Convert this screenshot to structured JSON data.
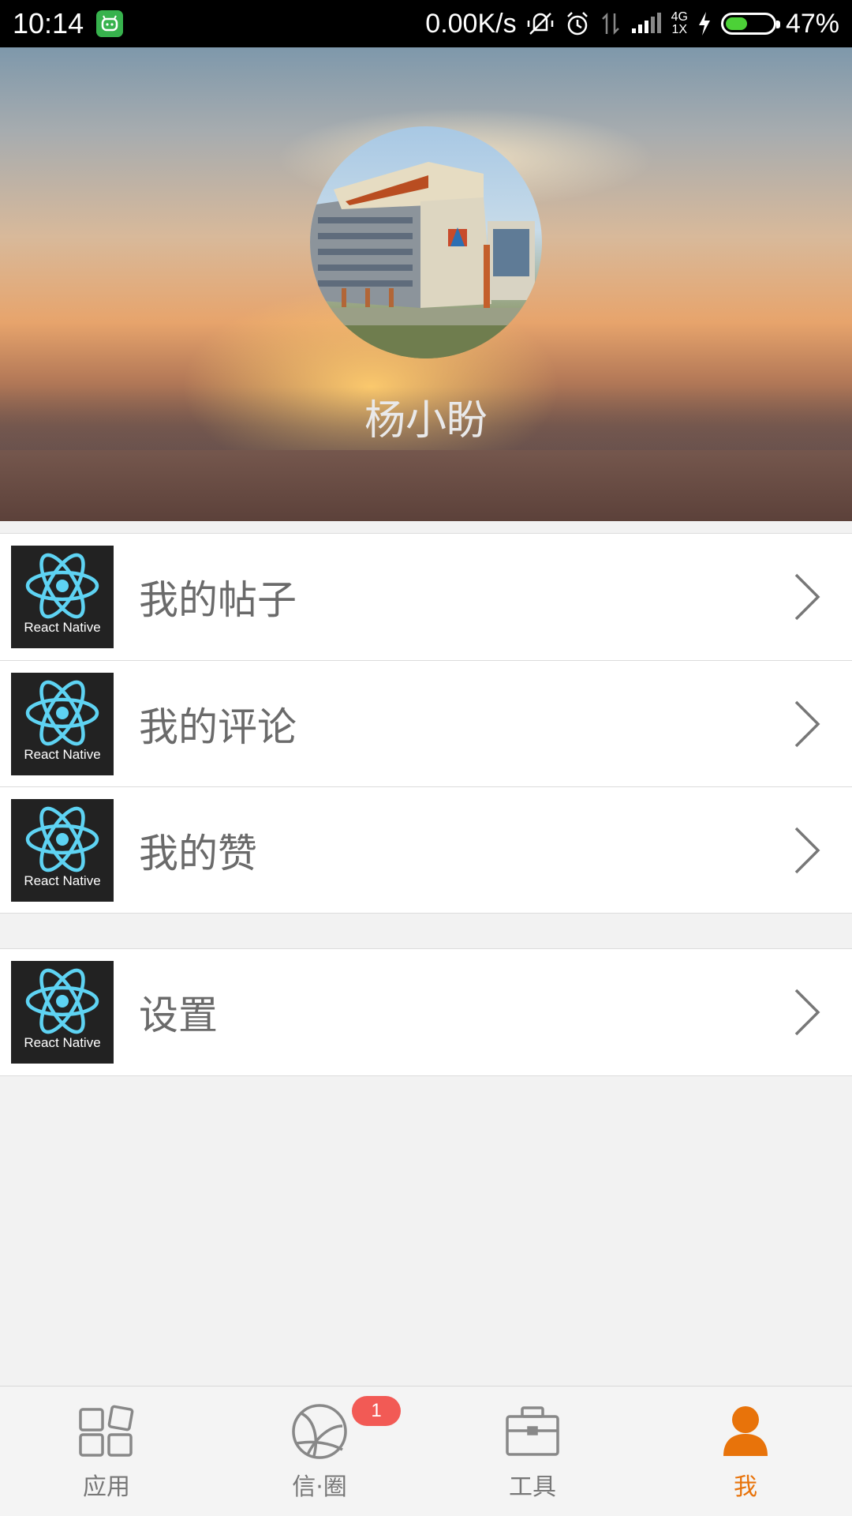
{
  "status_bar": {
    "time": "10:14",
    "network_speed": "0.00K/s",
    "network_type_top": "4G",
    "network_type_bottom": "1X",
    "battery_percent": "47%",
    "battery_level": 0.47,
    "icons": [
      "app-notification-icon",
      "vibrate-off-icon",
      "alarm-icon",
      "data-transfer-icon",
      "signal-icon",
      "charging-icon",
      "battery-icon"
    ]
  },
  "profile": {
    "username": "杨小盼"
  },
  "menu": {
    "group1": [
      {
        "label": "我的帖子",
        "icon_text": "React Native"
      },
      {
        "label": "我的评论",
        "icon_text": "React Native"
      },
      {
        "label": "我的赞",
        "icon_text": "React Native"
      }
    ],
    "group2": [
      {
        "label": "设置",
        "icon_text": "React Native"
      }
    ]
  },
  "tab_bar": {
    "tabs": [
      {
        "label": "应用",
        "icon": "apps-icon"
      },
      {
        "label": "信·圈",
        "icon": "circle-icon",
        "badge": "1"
      },
      {
        "label": "工具",
        "icon": "toolbox-icon"
      },
      {
        "label": "我",
        "icon": "person-icon",
        "active": true
      }
    ],
    "active_color": "#e8730a"
  }
}
